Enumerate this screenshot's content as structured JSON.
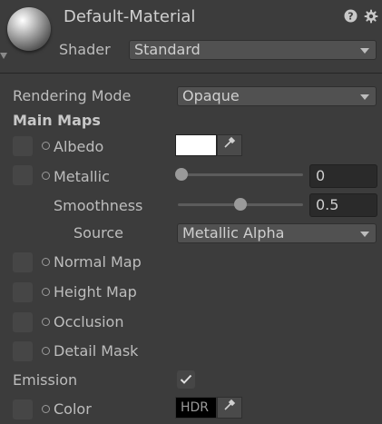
{
  "header": {
    "title": "Default-Material",
    "help_icon": "help-icon",
    "settings_icon": "gear-icon",
    "shader_label": "Shader",
    "shader_value": "Standard"
  },
  "rendering_mode": {
    "label": "Rendering Mode",
    "value": "Opaque"
  },
  "main_maps": {
    "heading": "Main Maps",
    "albedo": {
      "label": "Albedo",
      "color": "#ffffff"
    },
    "metallic": {
      "label": "Metallic",
      "value": "0",
      "fraction": 0
    },
    "smoothness": {
      "label": "Smoothness",
      "value": "0.5",
      "fraction": 0.5
    },
    "source": {
      "label": "Source",
      "value": "Metallic Alpha"
    },
    "normal_map": {
      "label": "Normal Map"
    },
    "height_map": {
      "label": "Height Map"
    },
    "occlusion": {
      "label": "Occlusion"
    },
    "detail_mask": {
      "label": "Detail Mask"
    }
  },
  "emission": {
    "label": "Emission",
    "checked": true,
    "color_label": "Color",
    "color_badge": "HDR"
  }
}
